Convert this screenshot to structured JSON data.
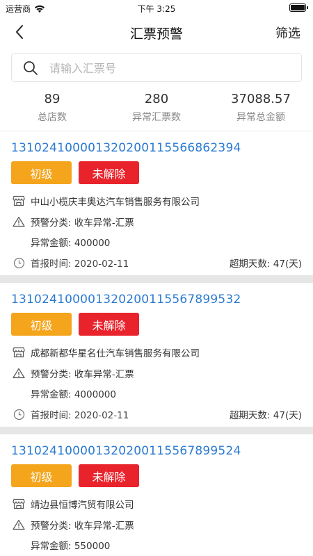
{
  "status_bar": {
    "carrier": "运营商",
    "time": "下午 3:25"
  },
  "nav": {
    "title": "汇票预警",
    "filter_label": "筛选"
  },
  "search": {
    "placeholder": "请输入汇票号",
    "value": ""
  },
  "stats": [
    {
      "value": "89",
      "label": "总店数"
    },
    {
      "value": "280",
      "label": "异常汇票数"
    },
    {
      "value": "37088.57",
      "label": "异常总金额"
    }
  ],
  "records": [
    {
      "ticket_no": "131024100001320200115566862394",
      "level": "初级",
      "status": "未解除",
      "company": "中山小榄庆丰奥达汽车销售服务有限公司",
      "category": "预警分类: 收车异常-汇票",
      "amount": "异常金额: 400000",
      "reported": "首报时间: 2020-02-11",
      "overdue": "超期天数: 47(天)"
    },
    {
      "ticket_no": "131024100001320200115567899532",
      "level": "初级",
      "status": "未解除",
      "company": "成都新都华星名仕汽车销售服务有限公司",
      "category": "预警分类: 收车异常-汇票",
      "amount": "异常金额: 4000000",
      "reported": "首报时间: 2020-02-11",
      "overdue": "超期天数: 47(天)"
    },
    {
      "ticket_no": "131024100001320200115567899524",
      "level": "初级",
      "status": "未解除",
      "company": "靖边县恒博汽贸有限公司",
      "category": "预警分类: 收车异常-汇票",
      "amount": "异常金额: 550000",
      "reported": "",
      "overdue": ""
    }
  ],
  "colors": {
    "link_blue": "#2a7ad2",
    "level_orange": "#f4a51c",
    "status_red": "#e9232c",
    "separator_gray": "#e6e6e6"
  },
  "icons": {
    "back": "chevron-left-icon",
    "search": "search-icon",
    "company": "store-icon",
    "category": "warning-icon",
    "date": "clock-icon"
  }
}
